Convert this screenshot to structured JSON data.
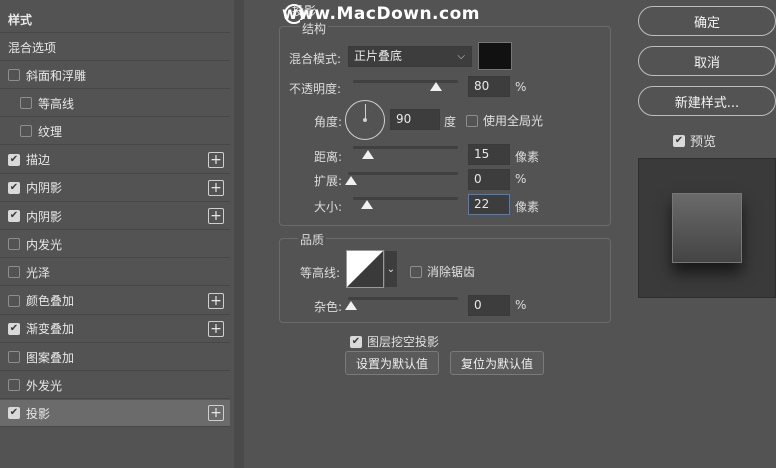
{
  "watermark": "www.MacDown.com",
  "styles_list": {
    "header": "样式",
    "blend_options": "混合选项",
    "items": [
      {
        "label": "斜面和浮雕",
        "checked": false,
        "indent": false,
        "plus": false
      },
      {
        "label": "等高线",
        "checked": false,
        "indent": true,
        "plus": false
      },
      {
        "label": "纹理",
        "checked": false,
        "indent": true,
        "plus": false
      },
      {
        "label": "描边",
        "checked": true,
        "indent": false,
        "plus": true
      },
      {
        "label": "内阴影",
        "checked": true,
        "indent": false,
        "plus": true
      },
      {
        "label": "内阴影",
        "checked": true,
        "indent": false,
        "plus": true
      },
      {
        "label": "内发光",
        "checked": false,
        "indent": false,
        "plus": false
      },
      {
        "label": "光泽",
        "checked": false,
        "indent": false,
        "plus": false
      },
      {
        "label": "颜色叠加",
        "checked": false,
        "indent": false,
        "plus": true
      },
      {
        "label": "渐变叠加",
        "checked": true,
        "indent": false,
        "plus": true
      },
      {
        "label": "图案叠加",
        "checked": false,
        "indent": false,
        "plus": false
      },
      {
        "label": "外发光",
        "checked": false,
        "indent": false,
        "plus": false
      },
      {
        "label": "投影",
        "checked": true,
        "indent": false,
        "plus": true,
        "selected": true
      }
    ],
    "plus_glyph": "+"
  },
  "structure": {
    "section_title": "投影",
    "group_title": "结构",
    "blend_mode_label": "混合模式:",
    "blend_mode_value": "正片叠底",
    "shadow_color": "#111111",
    "opacity_label": "不透明度:",
    "opacity_value": "80",
    "opacity_unit": "%",
    "opacity_level": 80,
    "angle_label": "角度:",
    "angle_value": "90",
    "angle_unit": "度",
    "global_light_label": "使用全局光",
    "global_light_checked": false,
    "distance_label": "距离:",
    "distance_value": "15",
    "distance_unit": "像素",
    "spread_label": "扩展:",
    "spread_value": "0",
    "spread_unit": "%",
    "size_label": "大小:",
    "size_value": "22",
    "size_unit": "像素"
  },
  "quality": {
    "group_title": "品质",
    "contour_label": "等高线:",
    "anti_alias_label": "消除锯齿",
    "anti_alias_checked": false,
    "noise_label": "杂色:",
    "noise_value": "0",
    "noise_unit": "%"
  },
  "layer_knocks_out_label": "图层挖空投影",
  "layer_knocks_out_checked": true,
  "set_default_label": "设置为默认值",
  "reset_default_label": "复位为默认值",
  "right": {
    "ok_label": "确定",
    "cancel_label": "取消",
    "new_style_label": "新建样式...",
    "preview_label": "预览",
    "preview_checked": true
  }
}
